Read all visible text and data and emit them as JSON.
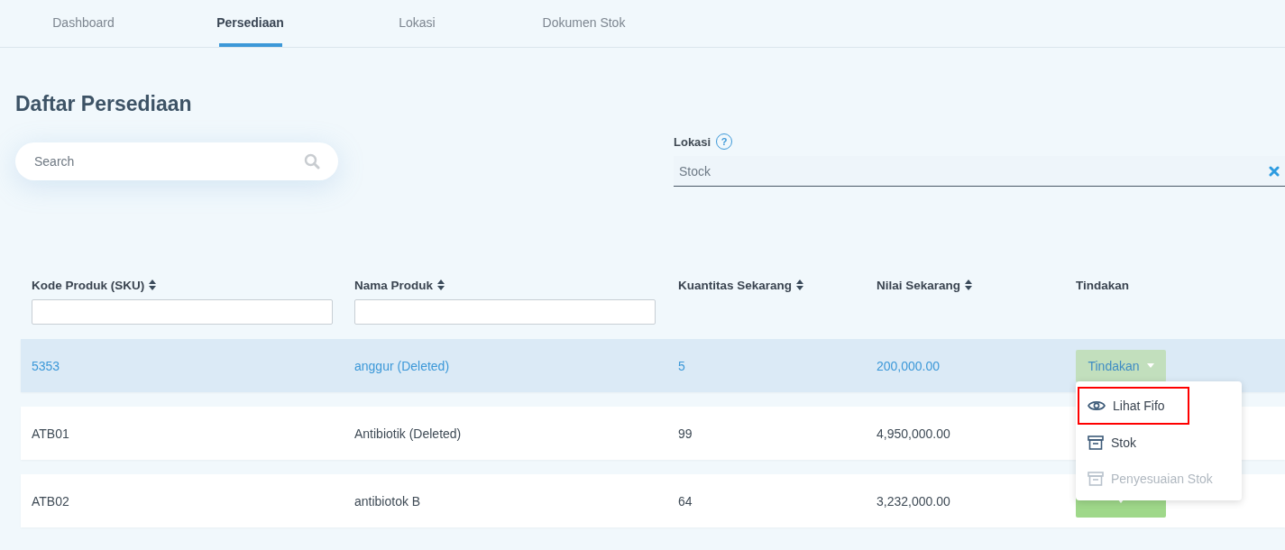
{
  "tabs": [
    {
      "label": "Dashboard",
      "selected": false
    },
    {
      "label": "Persediaan",
      "selected": true
    },
    {
      "label": "Lokasi",
      "selected": false
    },
    {
      "label": "Dokumen Stok",
      "selected": false
    }
  ],
  "page_title": "Daftar Persediaan",
  "search": {
    "placeholder": "Search"
  },
  "location_filter": {
    "label": "Lokasi",
    "help": "?",
    "value": "Stock"
  },
  "table": {
    "columns": [
      {
        "label": "Kode Produk (SKU)",
        "kind": "filterable"
      },
      {
        "label": "Nama Produk",
        "kind": "filterable"
      },
      {
        "label": "Kuantitas Sekarang",
        "kind": "sortable"
      },
      {
        "label": "Nilai Sekarang",
        "kind": "sortable"
      },
      {
        "label": "Tindakan",
        "kind": "plain"
      }
    ],
    "rows": [
      {
        "cells": [
          "5353",
          "anggur (Deleted)",
          "5",
          "200,000.00"
        ],
        "selected": true,
        "action": {
          "label": "Tindakan",
          "open": true
        }
      },
      {
        "cells": [
          "ATB01",
          "Antibiotik (Deleted)",
          "99",
          "4,950,000.00"
        ],
        "selected": false
      },
      {
        "cells": [
          "ATB02",
          "antibiotok B",
          "64",
          "3,232,000.00"
        ],
        "selected": false,
        "action": {
          "open": false
        }
      }
    ]
  },
  "action_menu": {
    "items": [
      {
        "label": "Lihat Fifo",
        "kind": "eye",
        "disabled": false,
        "highlighted": true
      },
      {
        "label": "Stok",
        "kind": "box",
        "disabled": false,
        "highlighted": false
      },
      {
        "label": "Penyesuaian Stok",
        "kind": "box",
        "disabled": true,
        "highlighted": false
      }
    ]
  }
}
